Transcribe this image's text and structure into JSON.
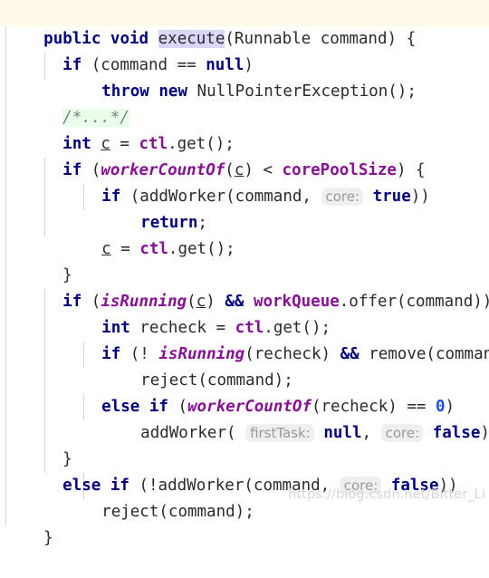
{
  "editor": {
    "language": "Java",
    "theme": "IntelliJ Light",
    "colors": {
      "background": "#ffffff",
      "keyword": "#000080",
      "field": "#871094",
      "number": "#1750eb",
      "comment": "#808080",
      "text": "#2b2b2b",
      "caret_line_highlight": "#fffae8",
      "identifier_under_caret_highlight": "#dbd7fb",
      "folded_comment_highlight": "#eaffea",
      "inlay_hint_background": "#efefef",
      "inlay_hint_text": "#999999",
      "indent_guide": "#d4d4d4",
      "watermark": "#d6d6d6"
    },
    "lines": [
      {
        "n": 1,
        "indent": 0,
        "caret": true,
        "text": "public void execute(Runnable command) {"
      },
      {
        "n": 2,
        "indent": 1,
        "caret": false,
        "text": "if (command == null)"
      },
      {
        "n": 3,
        "indent": 2,
        "caret": false,
        "text": "throw new NullPointerException();"
      },
      {
        "n": 4,
        "indent": 1,
        "caret": false,
        "text": "/*...*/"
      },
      {
        "n": 5,
        "indent": 1,
        "caret": false,
        "text": "int c = ctl.get();"
      },
      {
        "n": 6,
        "indent": 1,
        "caret": false,
        "text": "if (workerCountOf(c) < corePoolSize) {"
      },
      {
        "n": 7,
        "indent": 2,
        "caret": false,
        "text": "if (addWorker(command, core: true))"
      },
      {
        "n": 8,
        "indent": 3,
        "caret": false,
        "text": "return;"
      },
      {
        "n": 9,
        "indent": 2,
        "caret": false,
        "text": "c = ctl.get();"
      },
      {
        "n": 10,
        "indent": 1,
        "caret": false,
        "text": "}"
      },
      {
        "n": 11,
        "indent": 1,
        "caret": false,
        "text": "if (isRunning(c) && workQueue.offer(command)) {"
      },
      {
        "n": 12,
        "indent": 2,
        "caret": false,
        "text": "int recheck = ctl.get();"
      },
      {
        "n": 13,
        "indent": 2,
        "caret": false,
        "text": "if (! isRunning(recheck) && remove(command))"
      },
      {
        "n": 14,
        "indent": 3,
        "caret": false,
        "text": "reject(command);"
      },
      {
        "n": 15,
        "indent": 2,
        "caret": false,
        "text": "else if (workerCountOf(recheck) == 0)"
      },
      {
        "n": 16,
        "indent": 3,
        "caret": false,
        "text": "addWorker( firstTask: null,  core: false);"
      },
      {
        "n": 17,
        "indent": 1,
        "caret": false,
        "text": "}"
      },
      {
        "n": 18,
        "indent": 1,
        "caret": false,
        "text": "else if (!addWorker(command,  core: false))"
      },
      {
        "n": 19,
        "indent": 2,
        "caret": false,
        "text": "reject(command);"
      },
      {
        "n": 20,
        "indent": 0,
        "caret": false,
        "text": "}"
      }
    ],
    "inlay_hints": [
      {
        "label": "core:",
        "on_line": 7
      },
      {
        "label": "firstTask:",
        "on_line": 16
      },
      {
        "label": "core:",
        "on_line": 16
      },
      {
        "label": "core:",
        "on_line": 18
      }
    ],
    "watermark": "https://blog.csdn.net/Bitter_Li",
    "tokens": {
      "l1": {
        "t1": "public",
        "t2": " ",
        "t3": "void",
        "t4": " ",
        "t5": "execute",
        "t6": "(Runnable command) {"
      },
      "l2": {
        "t1": "if",
        "t2": " (command ",
        "t3": "==",
        "t4": " ",
        "t5": "null",
        "t6": ")"
      },
      "l3": {
        "t1": "throw",
        "t2": " ",
        "t3": "new",
        "t4": " NullPointerException();"
      },
      "l4": {
        "t1": "/*...*/"
      },
      "l5": {
        "t1": "int",
        "t2": " ",
        "t3": "c",
        "t4": " = ",
        "t5": "ctl",
        "t6": ".get();"
      },
      "l6": {
        "t1": "if",
        "t2": " (",
        "t3": "workerCountOf",
        "t4": "(",
        "t5": "c",
        "t6": ") < ",
        "t7": "corePoolSize",
        "t8": ") {"
      },
      "l7": {
        "t1": "if",
        "t2": " (addWorker(command, ",
        "t3": "core:",
        "t4": " ",
        "t5": "true",
        "t6": "))"
      },
      "l8": {
        "t1": "return",
        "t2": ";"
      },
      "l9": {
        "t1": "c",
        "t2": " = ",
        "t3": "ctl",
        "t4": ".get();"
      },
      "l10": {
        "t1": "}"
      },
      "l11": {
        "t1": "if",
        "t2": " (",
        "t3": "isRunning",
        "t4": "(",
        "t5": "c",
        "t6": ") ",
        "t7": "&&",
        "t8": " ",
        "t9": "workQueue",
        "t10": ".offer(command)) {"
      },
      "l12": {
        "t1": "int",
        "t2": " recheck = ",
        "t3": "ctl",
        "t4": ".get();"
      },
      "l13": {
        "t1": "if",
        "t2": " (! ",
        "t3": "isRunning",
        "t4": "(recheck) ",
        "t5": "&&",
        "t6": " remove(command))"
      },
      "l14": {
        "t1": "reject(command);"
      },
      "l15": {
        "t1": "else",
        "t2": " ",
        "t3": "if",
        "t4": " (",
        "t5": "workerCountOf",
        "t6": "(recheck) == ",
        "t7": "0",
        "t8": ")"
      },
      "l16": {
        "t1": "addWorker( ",
        "t2": "firstTask:",
        "t3": " ",
        "t4": "null",
        "t5": ", ",
        "t6": "core:",
        "t7": " ",
        "t8": "false",
        "t9": ");"
      },
      "l17": {
        "t1": "}"
      },
      "l18": {
        "t1": "else",
        "t2": " ",
        "t3": "if",
        "t4": " (!addWorker(command, ",
        "t5": "core:",
        "t6": " ",
        "t7": "false",
        "t8": "))"
      },
      "l19": {
        "t1": "reject(command);"
      },
      "l20": {
        "t1": "}"
      }
    }
  }
}
